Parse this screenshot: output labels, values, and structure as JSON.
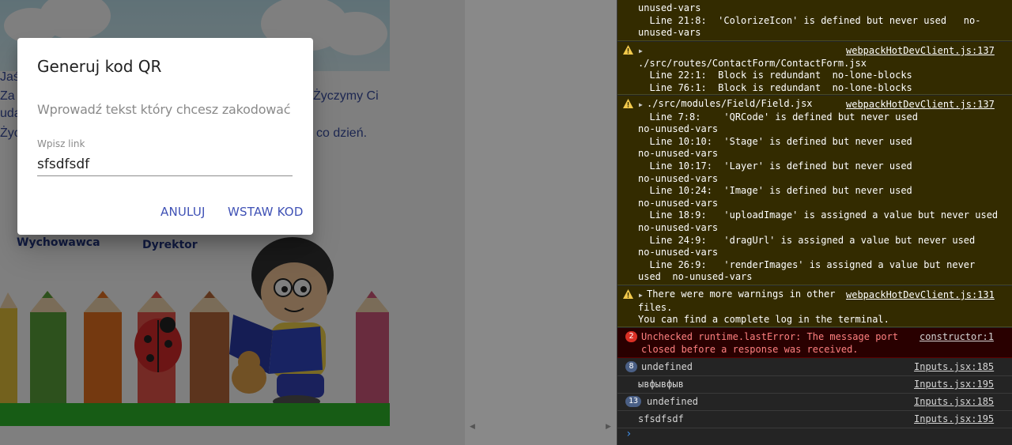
{
  "background_letter": {
    "lines": [
      {
        "prefix": "Jaś",
        "suffix": ""
      },
      {
        "prefix": "Za",
        "suffix": "Życzymy Ci"
      },
      {
        "prefix": "uda",
        "suffix": ""
      },
      {
        "prefix": "Życ",
        "suffix": "co dzień."
      }
    ],
    "signature_left": "Wychowawca",
    "signature_right": "Dyrektor"
  },
  "dialog": {
    "title": "Generuj kod QR",
    "description": "Wprowadź tekst który chcesz zakodować",
    "field_label": "Wpisz link",
    "field_value": "sfsdfsdf",
    "cancel_label": "ANULUJ",
    "insert_label": "WSTAW KOD"
  },
  "console": {
    "warning_top": {
      "lines": [
        "unused-vars",
        "  Line 21:8:  'ColorizeIcon' is defined but never used   no-",
        "unused-vars"
      ]
    },
    "warning_contact": {
      "source": "webpackHotDevClient.js:137",
      "lines": [
        "./src/routes/ContactForm/ContactForm.jsx",
        "  Line 22:1:  Block is redundant  no-lone-blocks",
        "  Line 76:1:  Block is redundant  no-lone-blocks"
      ]
    },
    "warning_field": {
      "header": "./src/modules/Field/Field.jsx",
      "source": "webpackHotDevClient.js:137",
      "lines": [
        "  Line 7:8:    'QRCode' is defined but never used",
        "no-unused-vars",
        "  Line 10:10:  'Stage' is defined but never used",
        "no-unused-vars",
        "  Line 10:17:  'Layer' is defined but never used",
        "no-unused-vars",
        "  Line 10:24:  'Image' is defined but never used",
        "no-unused-vars",
        "  Line 18:9:   'uploadImage' is assigned a value but never used",
        "no-unused-vars",
        "  Line 24:9:   'dragUrl' is assigned a value but never used",
        "no-unused-vars",
        "  Line 26:9:   'renderImages' is assigned a value but never",
        "used  no-unused-vars"
      ]
    },
    "warning_more": {
      "first": "There were more warnings in other",
      "source": "webpackHotDevClient.js:131",
      "lines": [
        "files.",
        "You can find a complete log in the terminal."
      ]
    },
    "error": {
      "count": "2",
      "lines": [
        "Unchecked runtime.lastError: The message port",
        "closed before a response was received."
      ],
      "source": "constructor:1"
    },
    "logs": [
      {
        "count": "8",
        "text": "undefined",
        "source": "Inputs.jsx:185"
      },
      {
        "count": "",
        "text": "ывфывфыв",
        "source": "Inputs.jsx:195"
      },
      {
        "count": "13",
        "text": "undefined",
        "source": "Inputs.jsx:185"
      },
      {
        "count": "",
        "text": "sfsdfsdf",
        "source": "Inputs.jsx:195"
      }
    ],
    "prompt": "›"
  },
  "colors": {
    "accent": "#3f51b5",
    "warning_bg": "#332b00",
    "error_bg": "#290000",
    "console_bg": "#242424"
  }
}
